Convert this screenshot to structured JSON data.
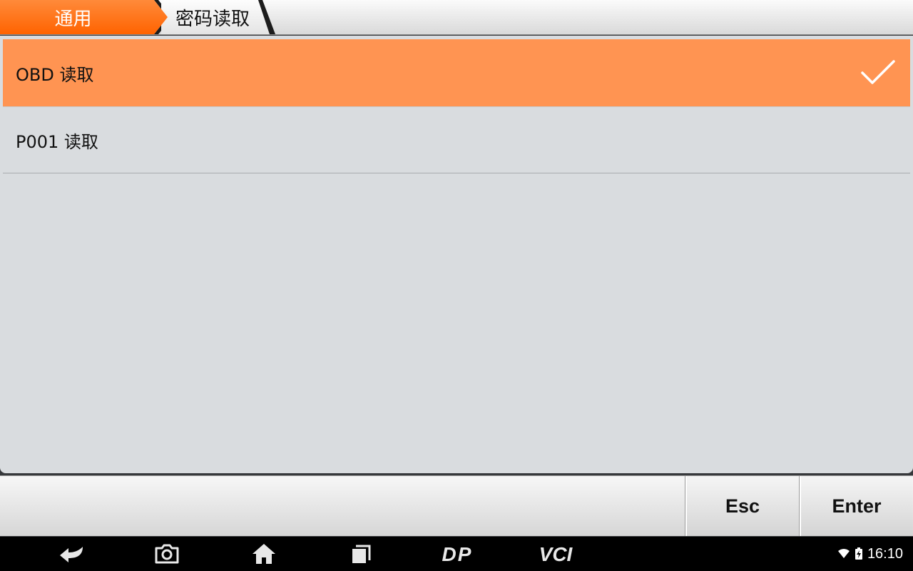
{
  "breadcrumb": {
    "home": "通用",
    "current": "密码读取"
  },
  "list": {
    "items": [
      {
        "label": "OBD 读取",
        "selected": true
      },
      {
        "label": "P001 读取",
        "selected": false
      }
    ]
  },
  "toolbar": {
    "esc_label": "Esc",
    "enter_label": "Enter"
  },
  "navbar": {
    "icons": [
      "back-icon",
      "camera-icon",
      "home-icon",
      "recent-apps-icon",
      "dp-icon",
      "vci-icon"
    ],
    "dp_text": "DP",
    "vci_text": "VCI"
  },
  "status": {
    "time": "16:10"
  },
  "colors": {
    "accent": "#ff6300",
    "selected_row": "#ff9452",
    "panel_bg": "#d9dcdf"
  }
}
